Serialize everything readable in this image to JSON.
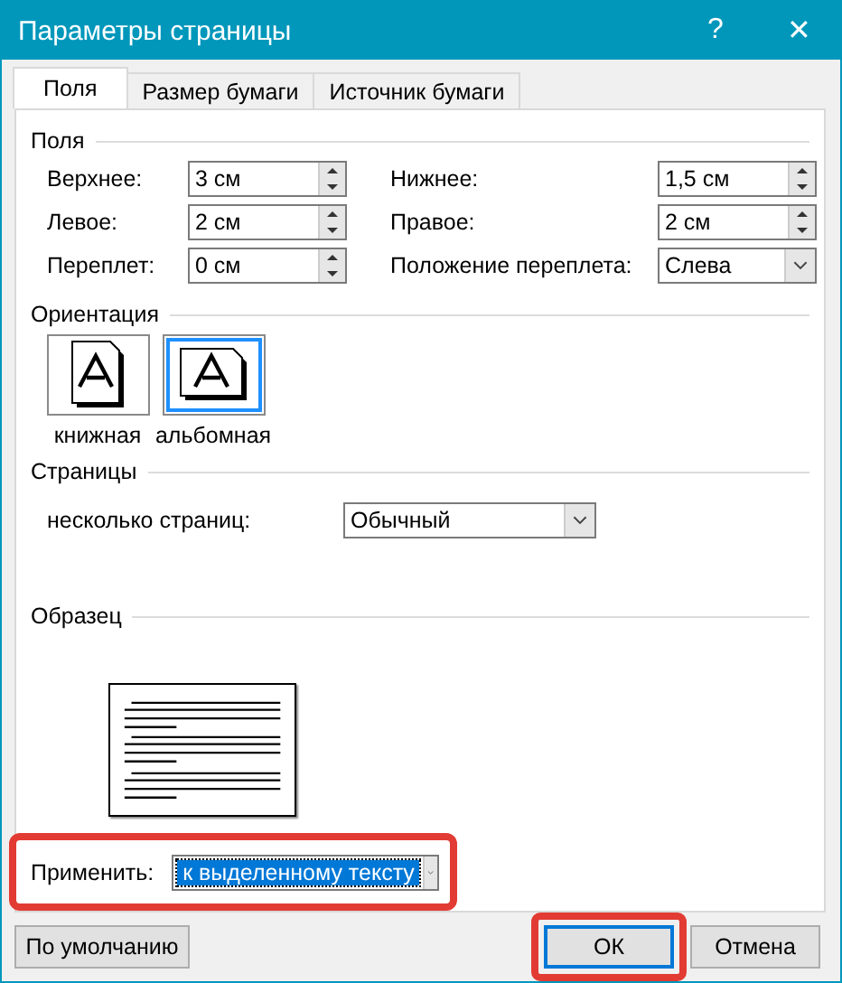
{
  "window": {
    "title": "Параметры страницы",
    "help": "?",
    "close": "✕"
  },
  "tabs": [
    {
      "label": "Поля",
      "selected": true
    },
    {
      "label": "Размер бумаги",
      "selected": false
    },
    {
      "label": "Источник бумаги",
      "selected": false
    }
  ],
  "margins": {
    "title": "Поля",
    "fields": [
      {
        "label": "Верхнее:",
        "value": "3 см",
        "kind": "spin"
      },
      {
        "label": "Нижнее:",
        "value": "1,5 см",
        "kind": "spin"
      },
      {
        "label": "Левое:",
        "value": "2 см",
        "kind": "spin"
      },
      {
        "label": "Правое:",
        "value": "2 см",
        "kind": "spin"
      },
      {
        "label": "Переплет:",
        "value": "0 см",
        "kind": "spin"
      },
      {
        "label": "Положение переплета:",
        "value": "Слева",
        "kind": "combo"
      }
    ]
  },
  "orientation": {
    "title": "Ориентация",
    "options": [
      {
        "label": "книжная",
        "kind": "portrait",
        "selected": false
      },
      {
        "label": "альбомная",
        "kind": "landscape",
        "selected": true
      }
    ]
  },
  "pages": {
    "title": "Страницы",
    "label": "несколько страниц:",
    "value": "Обычный"
  },
  "sample": {
    "title": "Образец"
  },
  "apply": {
    "label": "Применить:",
    "value": "к выделенному тексту",
    "highlighted": true
  },
  "buttons": [
    {
      "label": "По умолчанию",
      "kind": "default",
      "highlighted": false
    },
    {
      "label": "ОК",
      "kind": "ok",
      "highlighted": true
    },
    {
      "label": "Отмена",
      "kind": "cancel",
      "highlighted": false
    }
  ]
}
